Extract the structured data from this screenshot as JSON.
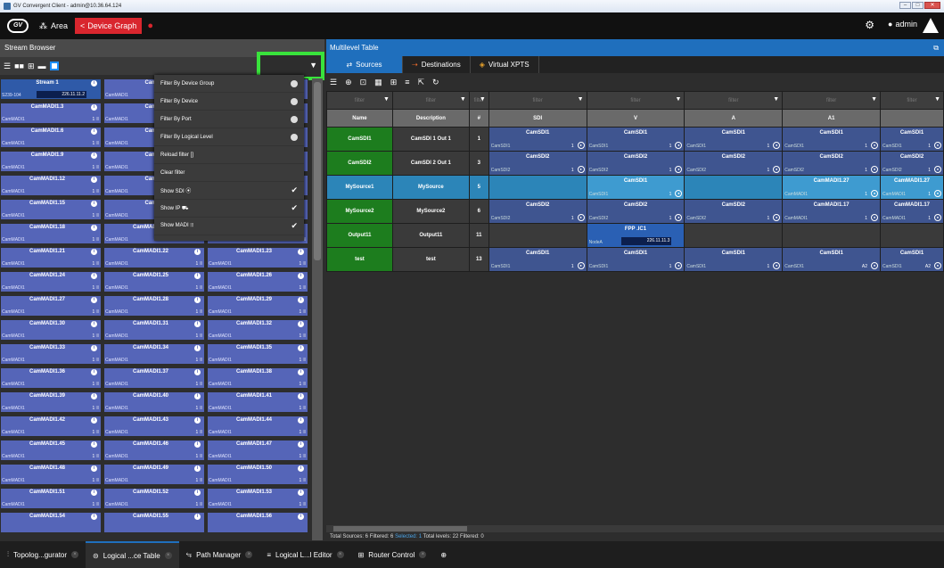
{
  "window": {
    "title": "GV Convergent Client - admin@10.36.64.124"
  },
  "topbar": {
    "area_label": "Area",
    "device_graph_label": "Device Graph",
    "user": "admin"
  },
  "stream_browser": {
    "title": "Stream Browser",
    "cards": [
      [
        {
          "name": "Stream 1",
          "label": "S239-104",
          "value": "226.11.11.2",
          "type": "ip"
        },
        {
          "name": "Cam",
          "label": "CamMADI1",
          "value": "",
          "type": "madi"
        },
        {
          "name": "",
          "label": "",
          "value": "",
          "type": "madi"
        }
      ],
      [
        {
          "name": "CamMADI1.3",
          "label": "CamMADI1",
          "value": "1"
        },
        {
          "name": "Cam",
          "label": "CamMADI1",
          "value": ""
        },
        {
          "name": "",
          "label": "",
          "value": ""
        }
      ],
      [
        {
          "name": "CamMADI1.6",
          "label": "CamMADI1",
          "value": "1"
        },
        {
          "name": "Cam",
          "label": "CamMADI1",
          "value": ""
        },
        {
          "name": "",
          "label": "",
          "value": ""
        }
      ],
      [
        {
          "name": "CamMADI1.9",
          "label": "CamMADI1",
          "value": "1"
        },
        {
          "name": "Cam",
          "label": "CamMADI1",
          "value": ""
        },
        {
          "name": "",
          "label": "",
          "value": ""
        }
      ],
      [
        {
          "name": "CamMADI1.12",
          "label": "CamMADI1",
          "value": "1"
        },
        {
          "name": "Cam",
          "label": "CamMADI1",
          "value": ""
        },
        {
          "name": "",
          "label": "",
          "value": ""
        }
      ],
      [
        {
          "name": "CamMADI1.15",
          "label": "CamMADI1",
          "value": "1"
        },
        {
          "name": "Cam",
          "label": "CamMADI1",
          "value": ""
        },
        {
          "name": "",
          "label": "",
          "value": ""
        }
      ],
      [
        {
          "name": "CamMADI1.18",
          "label": "CamMADI1",
          "value": "1"
        },
        {
          "name": "CamMADI1.19",
          "label": "CamMADI1",
          "value": "1"
        },
        {
          "name": "CamMADI1.20",
          "label": "CamMADI1",
          "value": "1"
        }
      ],
      [
        {
          "name": "CamMADI1.21",
          "label": "CamMADI1",
          "value": "1"
        },
        {
          "name": "CamMADI1.22",
          "label": "CamMADI1",
          "value": "1"
        },
        {
          "name": "CamMADI1.23",
          "label": "CamMADI1",
          "value": "1"
        }
      ],
      [
        {
          "name": "CamMADI1.24",
          "label": "CamMADI1",
          "value": "1"
        },
        {
          "name": "CamMADI1.25",
          "label": "CamMADI1",
          "value": "1"
        },
        {
          "name": "CamMADI1.26",
          "label": "CamMADI1",
          "value": "1"
        }
      ],
      [
        {
          "name": "CamMADI1.27",
          "label": "CamMADI1",
          "value": "1"
        },
        {
          "name": "CamMADI1.28",
          "label": "CamMADI1",
          "value": "1"
        },
        {
          "name": "CamMADI1.29",
          "label": "CamMADI1",
          "value": "1"
        }
      ],
      [
        {
          "name": "CamMADI1.30",
          "label": "CamMADI1",
          "value": "1"
        },
        {
          "name": "CamMADI1.31",
          "label": "CamMADI1",
          "value": "1"
        },
        {
          "name": "CamMADI1.32",
          "label": "CamMADI1",
          "value": "1"
        }
      ],
      [
        {
          "name": "CamMADI1.33",
          "label": "CamMADI1",
          "value": "1"
        },
        {
          "name": "CamMADI1.34",
          "label": "CamMADI1",
          "value": "1"
        },
        {
          "name": "CamMADI1.35",
          "label": "CamMADI1",
          "value": "1"
        }
      ],
      [
        {
          "name": "CamMADI1.36",
          "label": "CamMADI1",
          "value": "1"
        },
        {
          "name": "CamMADI1.37",
          "label": "CamMADI1",
          "value": "1"
        },
        {
          "name": "CamMADI1.38",
          "label": "CamMADI1",
          "value": "1"
        }
      ],
      [
        {
          "name": "CamMADI1.39",
          "label": "CamMADI1",
          "value": "1"
        },
        {
          "name": "CamMADI1.40",
          "label": "CamMADI1",
          "value": "1"
        },
        {
          "name": "CamMADI1.41",
          "label": "CamMADI1",
          "value": "1"
        }
      ],
      [
        {
          "name": "CamMADI1.42",
          "label": "CamMADI1",
          "value": "1"
        },
        {
          "name": "CamMADI1.43",
          "label": "CamMADI1",
          "value": "1"
        },
        {
          "name": "CamMADI1.44",
          "label": "CamMADI1",
          "value": "1"
        }
      ],
      [
        {
          "name": "CamMADI1.45",
          "label": "CamMADI1",
          "value": "1"
        },
        {
          "name": "CamMADI1.46",
          "label": "CamMADI1",
          "value": "1"
        },
        {
          "name": "CamMADI1.47",
          "label": "CamMADI1",
          "value": "1"
        }
      ],
      [
        {
          "name": "CamMADI1.48",
          "label": "CamMADI1",
          "value": "1"
        },
        {
          "name": "CamMADI1.49",
          "label": "CamMADI1",
          "value": "1"
        },
        {
          "name": "CamMADI1.50",
          "label": "CamMADI1",
          "value": "1"
        }
      ],
      [
        {
          "name": "CamMADI1.51",
          "label": "CamMADI1",
          "value": "1"
        },
        {
          "name": "CamMADI1.52",
          "label": "CamMADI1",
          "value": "1"
        },
        {
          "name": "CamMADI1.53",
          "label": "CamMADI1",
          "value": "1"
        }
      ],
      [
        {
          "name": "CamMADI1.54",
          "label": "",
          "value": ""
        },
        {
          "name": "CamMADI1.55",
          "label": "",
          "value": ""
        },
        {
          "name": "CamMADI1.56",
          "label": "",
          "value": ""
        }
      ]
    ]
  },
  "filter_menu": {
    "items": [
      {
        "label": "Filter By Device Group",
        "mark": "radio"
      },
      {
        "label": "Filter By Device",
        "mark": "radio"
      },
      {
        "label": "Filter By Port",
        "mark": "radio"
      },
      {
        "label": "Filter By Logical Level",
        "mark": "radio"
      },
      {
        "label": "Reload filter []",
        "mark": ""
      },
      {
        "label": "Clear filter",
        "mark": ""
      },
      {
        "label": "Show SDI ⦿",
        "mark": "check"
      },
      {
        "label": "Show IP ⛟",
        "mark": "check"
      },
      {
        "label": "Show MADI ⦙⦙⦙",
        "mark": "check"
      }
    ]
  },
  "multilevel": {
    "title": "Multilevel Table",
    "tabs": [
      "Sources",
      "Destinations",
      "Virtual XPTS"
    ],
    "filter_placeholder": "filter",
    "headers": [
      "Name",
      "Description",
      "#",
      "SDI",
      "V",
      "A",
      "A1"
    ],
    "rows": [
      {
        "name": "CamSDI1",
        "desc": "CamSDI 1 Out 1",
        "num": "1",
        "cells": [
          {
            "t": "CamSDI1",
            "b": "CamSDI1",
            "v": "1"
          },
          {
            "t": "CamSDI1",
            "b": "CamSDI1",
            "v": "1"
          },
          {
            "t": "CamSDI1",
            "b": "CamSDI1",
            "v": "1"
          },
          {
            "t": "CamSDI1",
            "b": "CamSDI1",
            "v": "1"
          }
        ]
      },
      {
        "name": "CamSDI2",
        "desc": "CamSDI 2 Out 1",
        "num": "3",
        "cells": [
          {
            "t": "CamSDI2",
            "b": "CamSDI2",
            "v": "1"
          },
          {
            "t": "CamSDI2",
            "b": "CamSDI2",
            "v": "1"
          },
          {
            "t": "CamSDI2",
            "b": "CamSDI2",
            "v": "1"
          },
          {
            "t": "CamSDI2",
            "b": "CamSDI2",
            "v": "1"
          }
        ]
      },
      {
        "name": "MySource1",
        "desc": "MySource",
        "num": "5",
        "sel": true,
        "cells": [
          null,
          {
            "t": "CamSDI1",
            "b": "CamSDI1",
            "v": "1"
          },
          null,
          {
            "t": "CamMADI1.27",
            "b": "CamMADI1",
            "v": "1"
          }
        ]
      },
      {
        "name": "MySource2",
        "desc": "MySource2",
        "num": "6",
        "cells": [
          {
            "t": "CamSDI2",
            "b": "CamSDI2",
            "v": "1"
          },
          {
            "t": "CamSDI2",
            "b": "CamSDI2",
            "v": "1"
          },
          {
            "t": "CamSDI2",
            "b": "CamSDI2",
            "v": "1"
          },
          {
            "t": "CamMADI1.17",
            "b": "CamMADI1",
            "v": "1"
          }
        ]
      },
      {
        "name": "Output11",
        "desc": "Output11",
        "num": "11",
        "cells": [
          null,
          {
            "t": "FPP .IC1",
            "b": "NodeA",
            "v": "226.11.11.3",
            "ip": true
          },
          null,
          null
        ]
      },
      {
        "name": "test",
        "desc": "test",
        "num": "13",
        "cells": [
          {
            "t": "CamSDI1",
            "b": "CamSDI1",
            "v": "1"
          },
          {
            "t": "CamSDI1",
            "b": "CamSDI1",
            "v": "1"
          },
          {
            "t": "CamSDI1",
            "b": "CamSDI1",
            "v": "1"
          },
          {
            "t": "CamSDI1",
            "b": "CamSDI1",
            "v": "A2"
          }
        ]
      }
    ],
    "status": {
      "total_sources": "Total Sources: 6",
      "filtered": "Filtered: 6",
      "selected": "Selected: 1",
      "total_levels": "Total levels: 22",
      "filtered2": "Filtered: 0"
    }
  },
  "bottom_tabs": [
    "Topolog...gurator",
    "Logical ...ce Table",
    "Path Manager",
    "Logical L...l Editor",
    "Router Control"
  ]
}
